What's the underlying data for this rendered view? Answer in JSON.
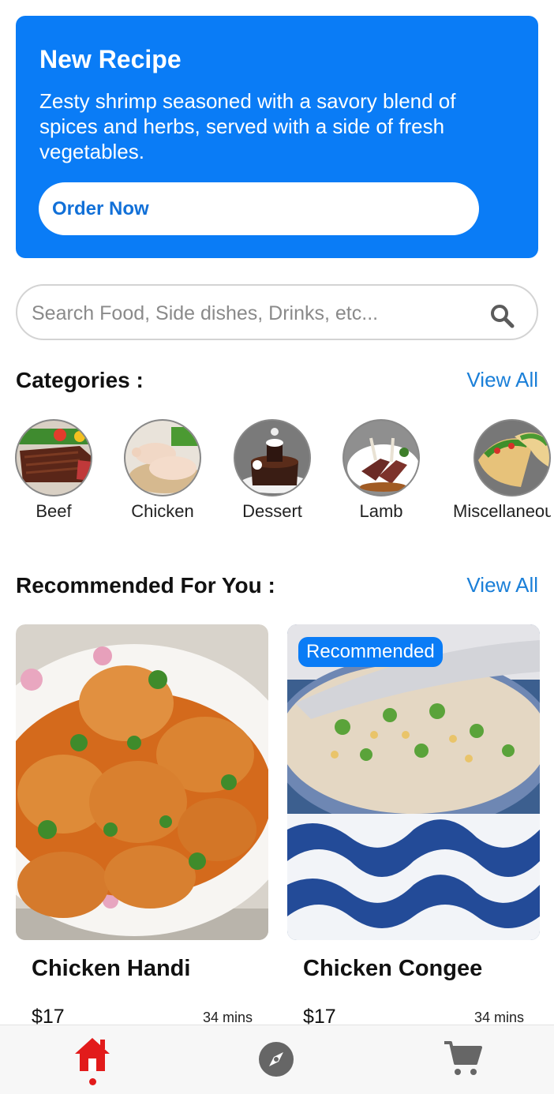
{
  "banner": {
    "title": "New Recipe",
    "description": "Zesty shrimp seasoned with a savory blend of spices and herbs, served with a side of fresh vegetables.",
    "button_label": "Order Now"
  },
  "search": {
    "placeholder": "Search Food, Side dishes, Drinks, etc...",
    "value": ""
  },
  "categories": {
    "title": "Categories :",
    "view_all": "View All",
    "items": [
      {
        "label": "Beef",
        "icon": "beef-image"
      },
      {
        "label": "Chicken",
        "icon": "chicken-image"
      },
      {
        "label": "Dessert",
        "icon": "dessert-image"
      },
      {
        "label": "Lamb",
        "icon": "lamb-image"
      },
      {
        "label": "Miscellaneous",
        "icon": "tacos-image"
      }
    ]
  },
  "recommended": {
    "title": "Recommended For You :",
    "view_all": "View All",
    "items": [
      {
        "name": "Chicken Handi",
        "price": "$17",
        "time": "34 mins",
        "badge": ""
      },
      {
        "name": "Chicken Congee",
        "price": "$17",
        "time": "34 mins",
        "badge": "Recommended"
      }
    ]
  },
  "nav": {
    "items": [
      {
        "icon": "home-icon",
        "active": true
      },
      {
        "icon": "compass-icon",
        "active": false
      },
      {
        "icon": "cart-icon",
        "active": false
      }
    ]
  },
  "colors": {
    "accent": "#0a7cf6",
    "link": "#1a7fd8",
    "nav_active": "#e21b1b",
    "nav_inactive": "#666666"
  }
}
